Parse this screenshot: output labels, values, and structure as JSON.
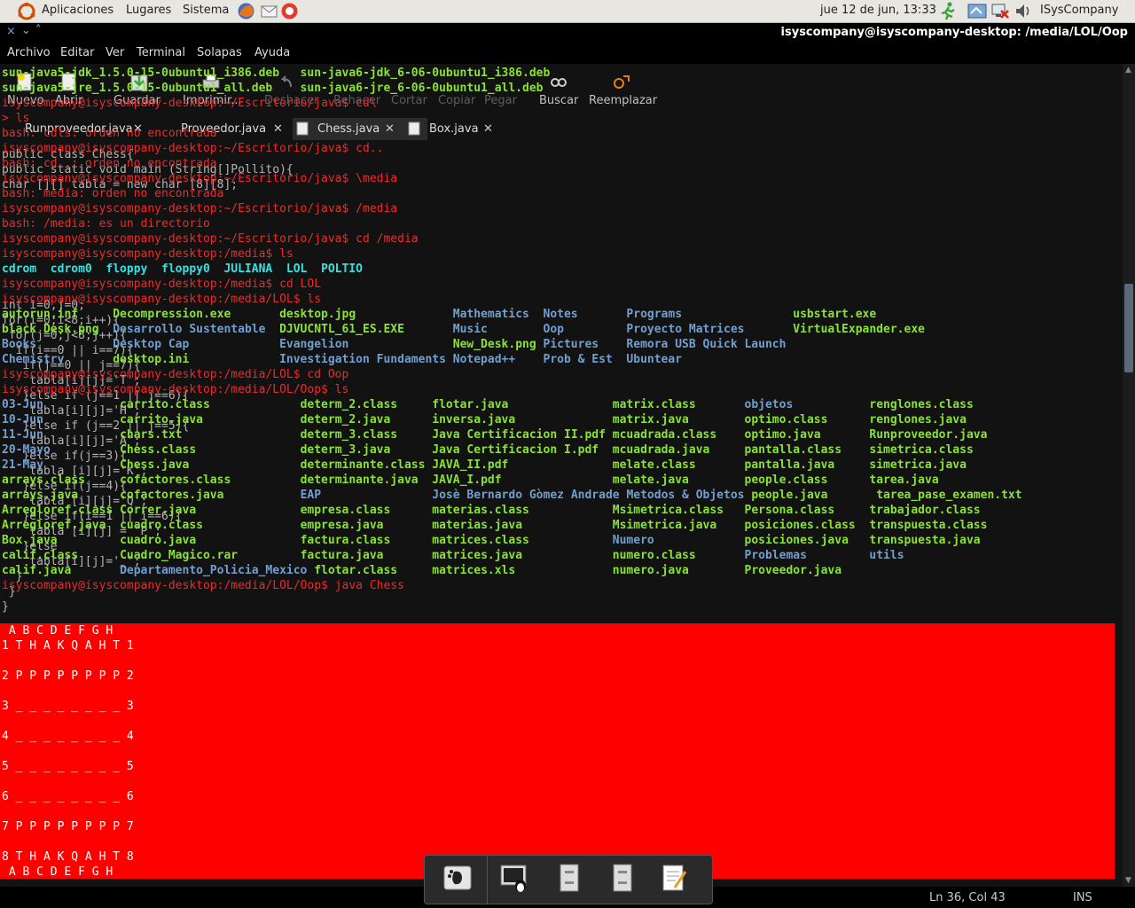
{
  "panel": {
    "apps": "Aplicaciones",
    "places": "Lugares",
    "system": "Sistema",
    "clock": "jue 12 de jun, 13:33",
    "user": "ISysCompany"
  },
  "window": {
    "title": "isyscompany@isyscompany-desktop: /media/LOL/Oop"
  },
  "menu": [
    "Archivo",
    "Editar",
    "Ver",
    "Terminal",
    "Solapas",
    "Ayuda"
  ],
  "editor_toolbar": [
    "Nuevo",
    "Abrir",
    "Guardar",
    "Imprimir...",
    "Deshacer",
    "Rehacer",
    "Cortar",
    "Copiar",
    "Pegar",
    "Buscar",
    "Reemplazar"
  ],
  "editor_tabs": [
    "Runproveedor.java",
    "Proveedor.java",
    "Chess.java",
    "Box.java"
  ],
  "terminal_lines": [
    {
      "segs": [
        {
          "t": "sun-java5-jdk_1.5.0-15-0ubuntu1_i386.deb   sun-java6-jdk_6-06-0ubuntu1_i386.deb",
          "c": "g"
        }
      ]
    },
    {
      "segs": [
        {
          "t": "sun-java5-jre_1.5.0-15-0ubuntu1_all.deb    sun-java6-jre_6-06-0ubuntu1_all.deb",
          "c": "g"
        }
      ]
    },
    {
      "segs": [
        {
          "t": "isyscompany@isyscompany-desktop:~/Escritorio/java$ cd\\",
          "c": "r"
        }
      ]
    },
    {
      "segs": [
        {
          "t": "> ls",
          "c": "r"
        }
      ]
    },
    {
      "segs": [
        {
          "t": "bash: cdls: orden no encontrada",
          "c": "r"
        }
      ]
    },
    {
      "segs": [
        {
          "t": "isyscompany@isyscompany-desktop:~/Escritorio/java$ cd..",
          "c": "r"
        }
      ]
    },
    {
      "segs": [
        {
          "t": "bash: cd..: orden no encontrada",
          "c": "r"
        }
      ]
    },
    {
      "segs": [
        {
          "t": "isyscompany@isyscompany-desktop:~/Escritorio/java$ \\media",
          "c": "r"
        }
      ]
    },
    {
      "segs": [
        {
          "t": "bash: media: orden no encontrada",
          "c": "r"
        }
      ]
    },
    {
      "segs": [
        {
          "t": "isyscompany@isyscompany-desktop:~/Escritorio/java$ /media",
          "c": "r"
        }
      ]
    },
    {
      "segs": [
        {
          "t": "bash: /media: es un directorio",
          "c": "r"
        }
      ]
    },
    {
      "segs": [
        {
          "t": "isyscompany@isyscompany-desktop:~/Escritorio/java$ cd /media",
          "c": "r"
        }
      ]
    },
    {
      "segs": [
        {
          "t": "isyscompany@isyscompany-desktop:/media$ ls",
          "c": "r"
        }
      ]
    },
    {
      "segs": [
        {
          "t": "cdrom  cdrom0  floppy  floppy0  JULIANA  LOL  POLTIO",
          "c": "c"
        }
      ]
    },
    {
      "segs": [
        {
          "t": "isyscompany@isyscompany-desktop:/media$ cd LOL",
          "c": "r"
        }
      ]
    },
    {
      "segs": [
        {
          "t": "isyscompany@isyscompany-desktop:/media/LOL$ ls",
          "c": "r"
        }
      ]
    },
    {
      "segs": [
        {
          "t": "autorun.inf     ",
          "c": "g"
        },
        {
          "t": "Decompression.exe       ",
          "c": "g"
        },
        {
          "t": "desktop.jpg              ",
          "c": "g"
        },
        {
          "t": "Mathematics  ",
          "c": "b"
        },
        {
          "t": "Notes       ",
          "c": "b"
        },
        {
          "t": "Programs                ",
          "c": "b"
        },
        {
          "t": "usbstart.exe",
          "c": "g"
        }
      ]
    },
    {
      "segs": [
        {
          "t": "black Desk.png  ",
          "c": "g"
        },
        {
          "t": "Desarrollo Sustentable  ",
          "c": "b"
        },
        {
          "t": "DJVUCNTL_61_ES.EXE       ",
          "c": "g"
        },
        {
          "t": "Music        ",
          "c": "b"
        },
        {
          "t": "Oop         ",
          "c": "b"
        },
        {
          "t": "Proyecto Matrices       ",
          "c": "b"
        },
        {
          "t": "VirtualExpander.exe",
          "c": "g"
        }
      ]
    },
    {
      "segs": [
        {
          "t": "Books           ",
          "c": "b"
        },
        {
          "t": "Desktop Cap             ",
          "c": "b"
        },
        {
          "t": "Evangelion               ",
          "c": "b"
        },
        {
          "t": "New_Desk.png ",
          "c": "g"
        },
        {
          "t": "Pictures    ",
          "c": "b"
        },
        {
          "t": "Remora USB Quick Launch",
          "c": "b"
        }
      ]
    },
    {
      "segs": [
        {
          "t": "Chemistry       ",
          "c": "b"
        },
        {
          "t": "desktop.ini             ",
          "c": "g"
        },
        {
          "t": "Investigation Fundaments ",
          "c": "b"
        },
        {
          "t": "Notepad++    ",
          "c": "b"
        },
        {
          "t": "Prob & Est  ",
          "c": "b"
        },
        {
          "t": "Ubuntear",
          "c": "b"
        }
      ]
    },
    {
      "segs": [
        {
          "t": "isyscompany@isyscompany-desktop:/media/LOL$ cd Oop",
          "c": "r"
        }
      ]
    },
    {
      "segs": [
        {
          "t": "isyscompany@isyscompany-desktop:/media/LOL/Oop$ ls",
          "c": "r"
        }
      ]
    },
    {
      "segs": [
        {
          "t": "03-Jun           ",
          "c": "b"
        },
        {
          "t": "carrito.class             ",
          "c": "g"
        },
        {
          "t": "determ_2.class     ",
          "c": "g"
        },
        {
          "t": "flotar.java               ",
          "c": "g"
        },
        {
          "t": "matrix.class       ",
          "c": "g"
        },
        {
          "t": "objetos           ",
          "c": "b"
        },
        {
          "t": "renglones.class",
          "c": "g"
        }
      ]
    },
    {
      "segs": [
        {
          "t": "10-Jun           ",
          "c": "b"
        },
        {
          "t": "carrito.java              ",
          "c": "g"
        },
        {
          "t": "determ_2.java      ",
          "c": "g"
        },
        {
          "t": "inversa.java              ",
          "c": "g"
        },
        {
          "t": "matrix.java        ",
          "c": "g"
        },
        {
          "t": "optimo.class      ",
          "c": "g"
        },
        {
          "t": "renglones.java",
          "c": "g"
        }
      ]
    },
    {
      "segs": [
        {
          "t": "11-Jun           ",
          "c": "b"
        },
        {
          "t": "chars.txt                 ",
          "c": "g"
        },
        {
          "t": "determ_3.class     ",
          "c": "g"
        },
        {
          "t": "Java Certificacion II.pdf ",
          "c": "g"
        },
        {
          "t": "mcuadrada.class    ",
          "c": "g"
        },
        {
          "t": "optimo.java       ",
          "c": "g"
        },
        {
          "t": "Runproveedor.java",
          "c": "g"
        }
      ]
    },
    {
      "segs": [
        {
          "t": "20-Mayo          ",
          "c": "b"
        },
        {
          "t": "Chess.class               ",
          "c": "g"
        },
        {
          "t": "determ_3.java      ",
          "c": "g"
        },
        {
          "t": "Java Certificacion I.pdf  ",
          "c": "g"
        },
        {
          "t": "mcuadrada.java     ",
          "c": "g"
        },
        {
          "t": "pantalla.class    ",
          "c": "g"
        },
        {
          "t": "simetrica.class",
          "c": "g"
        }
      ]
    },
    {
      "segs": [
        {
          "t": "21-May           ",
          "c": "b"
        },
        {
          "t": "Chess.java                ",
          "c": "g"
        },
        {
          "t": "determinante.class ",
          "c": "g"
        },
        {
          "t": "JAVA_II.pdf               ",
          "c": "g"
        },
        {
          "t": "melate.class       ",
          "c": "g"
        },
        {
          "t": "pantalla.java     ",
          "c": "g"
        },
        {
          "t": "simetrica.java",
          "c": "g"
        }
      ]
    },
    {
      "segs": [
        {
          "t": "arrays.class     ",
          "c": "g"
        },
        {
          "t": "cofactores.class          ",
          "c": "g"
        },
        {
          "t": "determinante.java  ",
          "c": "g"
        },
        {
          "t": "JAVA_I.pdf                ",
          "c": "g"
        },
        {
          "t": "melate.java        ",
          "c": "g"
        },
        {
          "t": "people.class      ",
          "c": "g"
        },
        {
          "t": "tarea.java",
          "c": "g"
        }
      ]
    },
    {
      "segs": [
        {
          "t": "arrays.java      ",
          "c": "g"
        },
        {
          "t": "cofactores.java           ",
          "c": "g"
        },
        {
          "t": "EAP                ",
          "c": "b"
        },
        {
          "t": "Josè Bernardo Gòmez Andrade ",
          "c": "b"
        },
        {
          "t": "Metodos & Objetos ",
          "c": "b"
        },
        {
          "t": "people.java       ",
          "c": "g"
        },
        {
          "t": "tarea_pase_examen.txt",
          "c": "g"
        }
      ]
    },
    {
      "segs": [
        {
          "t": "Arregloref.class ",
          "c": "g"
        },
        {
          "t": "Correr.java               ",
          "c": "g"
        },
        {
          "t": "empresa.class      ",
          "c": "g"
        },
        {
          "t": "materias.class            ",
          "c": "g"
        },
        {
          "t": "Msimetrica.class   ",
          "c": "g"
        },
        {
          "t": "Persona.class     ",
          "c": "g"
        },
        {
          "t": "trabajador.class",
          "c": "g"
        }
      ]
    },
    {
      "segs": [
        {
          "t": "Arregloref.java  ",
          "c": "g"
        },
        {
          "t": "cuadro.class              ",
          "c": "g"
        },
        {
          "t": "empresa.java       ",
          "c": "g"
        },
        {
          "t": "materias.java             ",
          "c": "g"
        },
        {
          "t": "Msimetrica.java    ",
          "c": "g"
        },
        {
          "t": "posiciones.class  ",
          "c": "g"
        },
        {
          "t": "transpuesta.class",
          "c": "g"
        }
      ]
    },
    {
      "segs": [
        {
          "t": "Box.java         ",
          "c": "g"
        },
        {
          "t": "cuadro.java               ",
          "c": "g"
        },
        {
          "t": "factura.class      ",
          "c": "g"
        },
        {
          "t": "matrices.class            ",
          "c": "g"
        },
        {
          "t": "Numero             ",
          "c": "b"
        },
        {
          "t": "posiciones.java   ",
          "c": "g"
        },
        {
          "t": "transpuesta.java",
          "c": "g"
        }
      ]
    },
    {
      "segs": [
        {
          "t": "calif.class      ",
          "c": "g"
        },
        {
          "t": "Cuadro_Magico.rar         ",
          "c": "g"
        },
        {
          "t": "factura.java       ",
          "c": "g"
        },
        {
          "t": "matrices.java             ",
          "c": "g"
        },
        {
          "t": "numero.class       ",
          "c": "g"
        },
        {
          "t": "Problemas         ",
          "c": "b"
        },
        {
          "t": "utils",
          "c": "b"
        }
      ]
    },
    {
      "segs": [
        {
          "t": "calif.java       ",
          "c": "g"
        },
        {
          "t": "Departamento_Policia_Mexico ",
          "c": "b"
        },
        {
          "t": "flotar.class     ",
          "c": "g"
        },
        {
          "t": "matrices.xls              ",
          "c": "g"
        },
        {
          "t": "numero.java        ",
          "c": "g"
        },
        {
          "t": "Proveedor.java",
          "c": "g"
        }
      ]
    },
    {
      "segs": [
        {
          "t": "isyscompany@isyscompany-desktop:/media/LOL/Oop$ java Chess",
          "c": "r"
        }
      ]
    }
  ],
  "ghost_code": [
    "public class Chess{",
    "public static void main (String[]Pollito){",
    "char [][] tabla = new char [8][8];",
    "",
    "",
    "",
    "",
    "",
    "",
    "",
    "int i=0,j=0;",
    "for(i=0;i<8;i++){",
    " for(j=0;j<8;j++){",
    "  if(i==0 || i==7){",
    "   if(j==0 || j==7){",
    "    tabla[i][j]='T';",
    "   }else if (j==1 || j==6){",
    "    tabla[i][j]='H';",
    "   }else if (j==2 || j==5){",
    "    tabla[i][j]='A';",
    "   }else if(j==3){",
    "    tabla [i][j]='K';",
    "   }else if(j==4){",
    "    tabla [i][j]='Q';",
    "   }else if(i==1 || i==6){",
    "    tabla [i][j] = 'P';",
    "   }else",
    "    tabla[i][j]='_';",
    "  }",
    " }",
    "}"
  ],
  "chess_output": [
    " A B C D E F G H",
    "1 T H A K Q A H T 1",
    "",
    "2 P P P P P P P P 2",
    "",
    "3 _ _ _ _ _ _ _ _ 3",
    "",
    "4 _ _ _ _ _ _ _ _ 4",
    "",
    "5 _ _ _ _ _ _ _ _ 5",
    "",
    "6 _ _ _ _ _ _ _ _ 6",
    "",
    "7 P P P P P P P P 7",
    "",
    "8 T H A K Q A H T 8",
    " A B C D E F G H"
  ],
  "status": {
    "position": "Ln 36, Col 43",
    "mode": "INS"
  },
  "colors": {
    "terminal_bg": "#121212",
    "prompt": "#ef2929",
    "file": "#8ae234",
    "dir": "#729fcf",
    "output_bg": "#ff0000"
  }
}
